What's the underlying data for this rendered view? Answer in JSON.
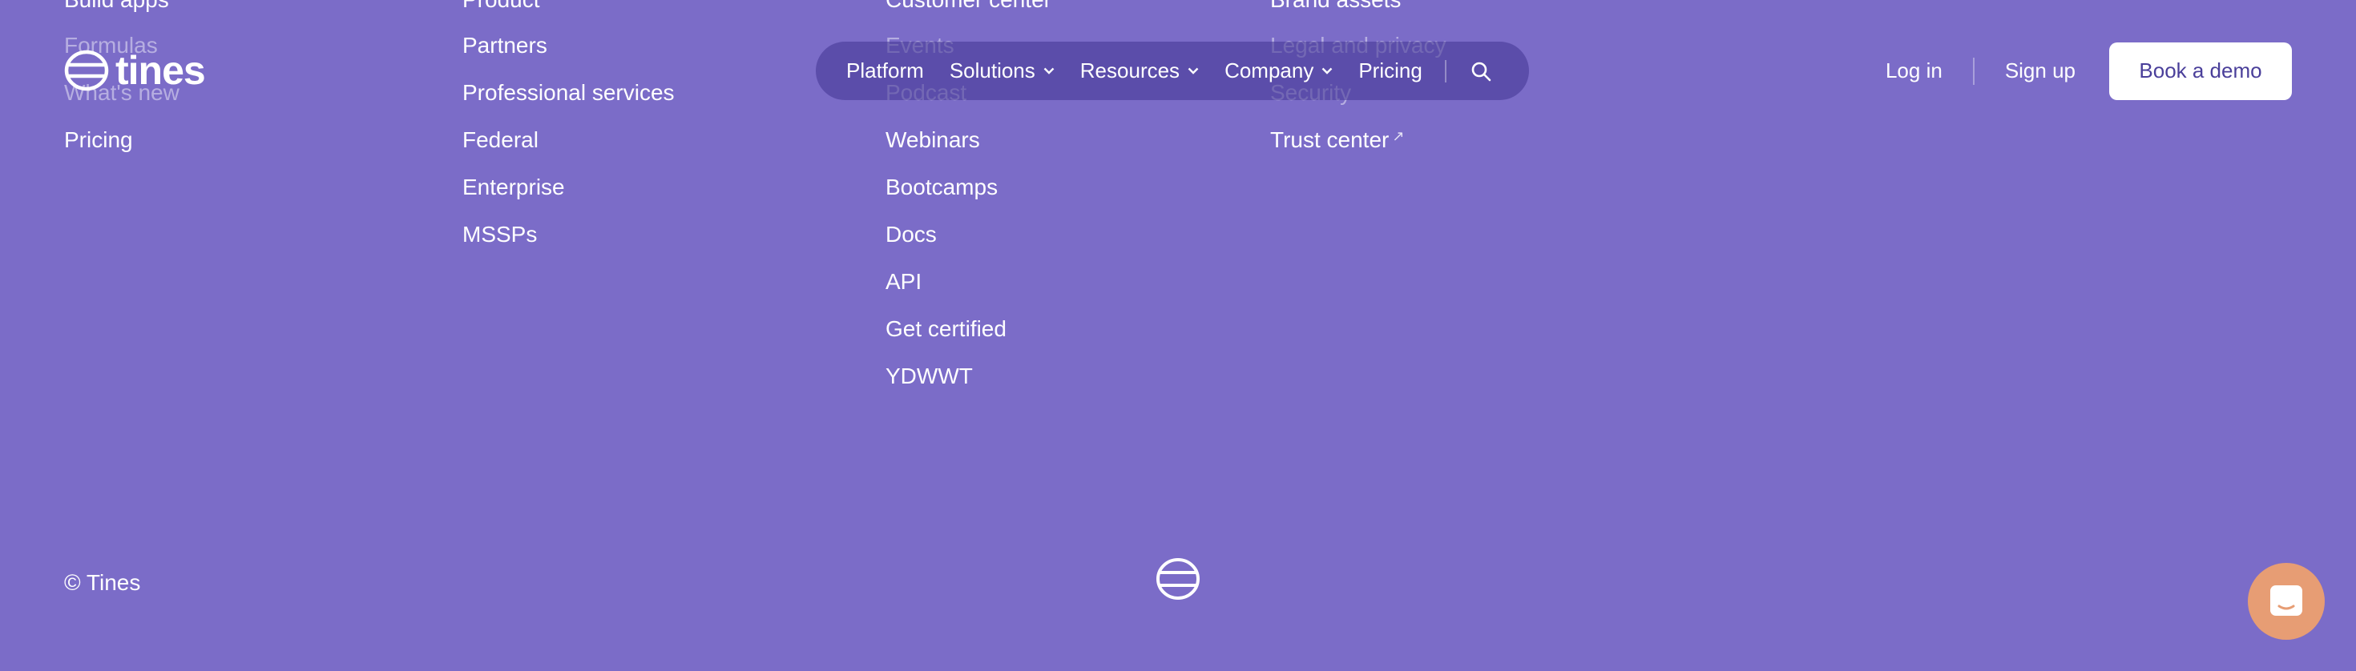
{
  "header": {
    "logo_text": "tines",
    "nav": [
      {
        "label": "Platform",
        "has_dropdown": false
      },
      {
        "label": "Solutions",
        "has_dropdown": true
      },
      {
        "label": "Resources",
        "has_dropdown": true
      },
      {
        "label": "Company",
        "has_dropdown": true
      },
      {
        "label": "Pricing",
        "has_dropdown": false
      }
    ],
    "login_label": "Log in",
    "signup_label": "Sign up",
    "demo_label": "Book a demo"
  },
  "footer": {
    "columns": [
      {
        "links": [
          "Build apps",
          "Formulas",
          "What's new",
          "Pricing"
        ]
      },
      {
        "links": [
          "Product",
          "Partners",
          "Professional services",
          "Federal",
          "Enterprise",
          "MSSPs"
        ]
      },
      {
        "links": [
          "Customer center",
          "Events",
          "Podcast",
          "Webinars",
          "Bootcamps",
          "Docs",
          "API",
          "Get certified",
          "YDWWT"
        ]
      },
      {
        "links": [
          "Brand assets",
          "Legal and privacy",
          "Security",
          "Trust center"
        ]
      }
    ],
    "copyright": "© Tines"
  },
  "colors": {
    "background": "#7B6CC8",
    "nav_pill": "#5A4BA8",
    "button_bg": "#FFFFFF",
    "button_text": "#4A3F9A",
    "chat_launcher": "#E79D74"
  },
  "icons": {
    "logo": "tines-logo-icon",
    "search": "search-icon",
    "chevron": "chevron-down-icon",
    "external": "external-link-icon",
    "chat": "chat-icon"
  }
}
